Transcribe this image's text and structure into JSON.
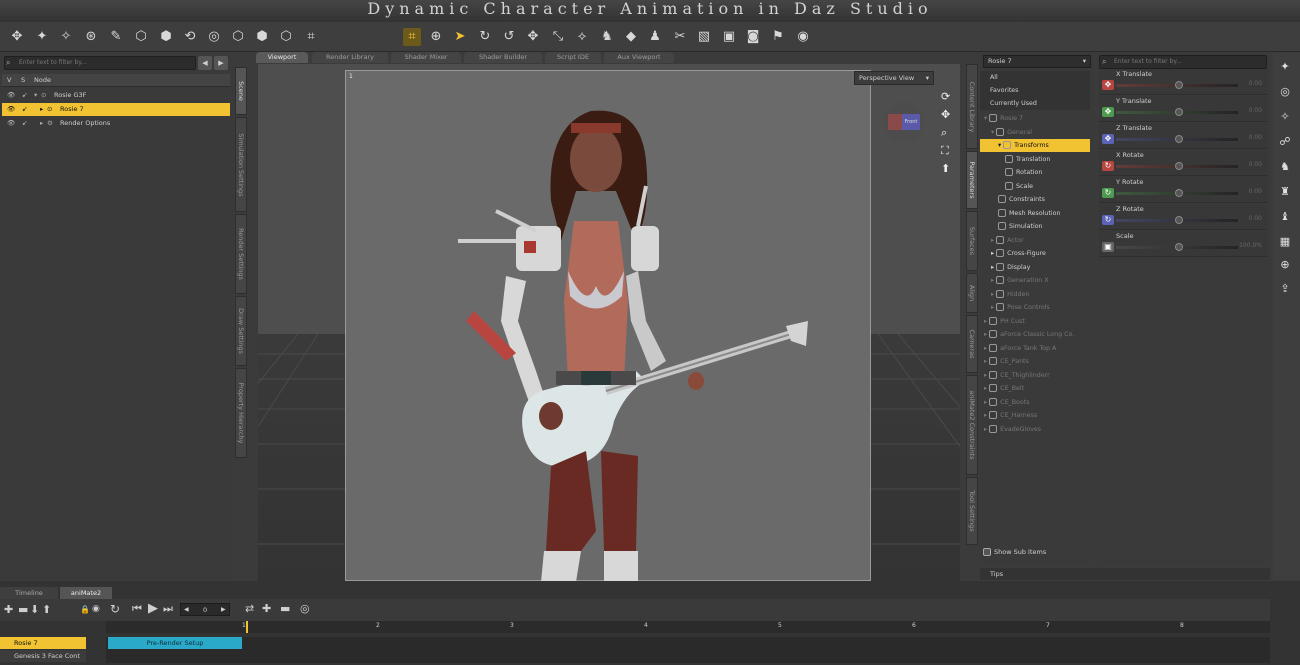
{
  "title": "Dynamic Character Animation in Daz Studio",
  "scene": {
    "filter_placeholder": "Enter text to filter by...",
    "col_v": "V",
    "col_s": "S",
    "col_node": "Node",
    "nodes": [
      "Rosie G3F",
      "Rosie 7",
      "Render Options"
    ]
  },
  "left_tabs": [
    "Scene",
    "Simulation Settings",
    "Render Settings",
    "Draw Settings",
    "Property Hierarchy"
  ],
  "viewport": {
    "tabs": [
      "Viewport",
      "Render Library",
      "Shader Mixer",
      "Shader Builder",
      "Script IDE",
      "Aux Viewport"
    ],
    "camera": "Perspective View",
    "frame_label": "1",
    "cube_label": "Front"
  },
  "right_tabs": [
    "Content Library",
    "Parameters",
    "Surfaces",
    "Align",
    "Cameras",
    "aniMate2 Constraints",
    "Tool Settings"
  ],
  "params": {
    "selector": "Rosie 7",
    "filter_placeholder": "Enter text to filter by...",
    "list_top": [
      "All",
      "Favorites",
      "Currently Used"
    ],
    "tree": [
      "Rosie 7",
      "General",
      "Transforms",
      "Translation",
      "Rotation",
      "Scale",
      "Constraints",
      "Mesh Resolution",
      "Simulation",
      "Actor",
      "Cross-Figure",
      "Display",
      "Generation X",
      "Hidden",
      "Pose Controls",
      "PH Cust",
      "aForce Classic Long Co.",
      "aForce Tank Top A",
      "CE_Pants",
      "CE_Thighlinderr",
      "CE_Belt",
      "CE_Boots",
      "CE_Harness",
      "EvadeGloves"
    ],
    "show_sub": "Show Sub Items",
    "tips": "Tips",
    "sliders": [
      {
        "label": "X Translate",
        "value": "0.00",
        "color": "#b8453f",
        "icon": "move-icon"
      },
      {
        "label": "Y Translate",
        "value": "0.00",
        "color": "#4e9a4e",
        "icon": "move-icon"
      },
      {
        "label": "Z Translate",
        "value": "0.00",
        "color": "#5c63b6",
        "icon": "move-icon"
      },
      {
        "label": "X Rotate",
        "value": "0.00",
        "color": "#b8453f",
        "icon": "rotate-icon"
      },
      {
        "label": "Y Rotate",
        "value": "0.00",
        "color": "#4e9a4e",
        "icon": "rotate-icon"
      },
      {
        "label": "Z Rotate",
        "value": "0.00",
        "color": "#5c63b6",
        "icon": "rotate-icon"
      },
      {
        "label": "Scale",
        "value": "100.0%",
        "color": "#666666",
        "icon": "scale-icon"
      }
    ]
  },
  "timeline": {
    "tabs": [
      "Timeline",
      "aniMate2"
    ],
    "frame_value": "0",
    "ruler": [
      "1",
      "2",
      "3",
      "4",
      "5",
      "6",
      "7",
      "8"
    ],
    "tracks": [
      "Rosie 7",
      "Genesis 3 Face Cont"
    ],
    "block_label": "Pre-Render Setup"
  },
  "colors": {
    "selection": "#f1c232",
    "block": "#2aa9c9"
  }
}
